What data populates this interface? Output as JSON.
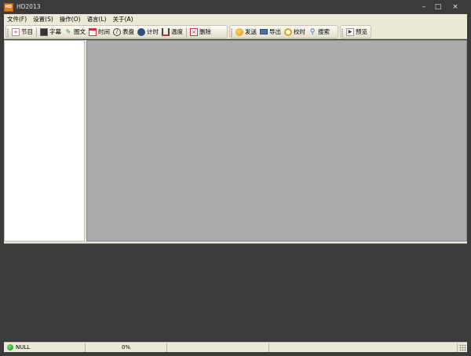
{
  "window": {
    "title": "HD2013",
    "icon_text": "HD",
    "controls": {
      "minimize": "–",
      "maximize": "□",
      "close": "×"
    }
  },
  "menu": [
    {
      "label": "文件(F)"
    },
    {
      "label": "设置(S)"
    },
    {
      "label": "操作(O)"
    },
    {
      "label": "语言(L)"
    },
    {
      "label": "关于(A)"
    }
  ],
  "toolbar": {
    "program": "节目",
    "subtitle": "字幕",
    "graphic_text": "图文",
    "time": "时间",
    "dial": "表盘",
    "timer": "计时",
    "temperature": "温度",
    "delete": "删除",
    "send": "发送",
    "export": "导出",
    "sync_time": "校时",
    "search": "搜索",
    "preview": "预览"
  },
  "icons": {
    "program": "document-icon",
    "subtitle": "text-screen-icon",
    "graphic_text": "image-edit-icon",
    "time": "calendar-icon",
    "dial": "clock-dial-icon",
    "timer": "stopwatch-icon",
    "temperature": "thermometer-icon",
    "delete": "delete-icon",
    "send": "send-icon",
    "export": "export-icon",
    "sync_time": "alarm-clock-icon",
    "search": "magnifier-icon",
    "preview": "play-icon"
  },
  "status": {
    "connection": "NULL",
    "progress": "0%",
    "connection_color": "#2ea02e"
  },
  "colors": {
    "chrome": "#3b3b3b",
    "toolbar_bg": "#ece9d8",
    "canvas_bg": "#ababab"
  }
}
